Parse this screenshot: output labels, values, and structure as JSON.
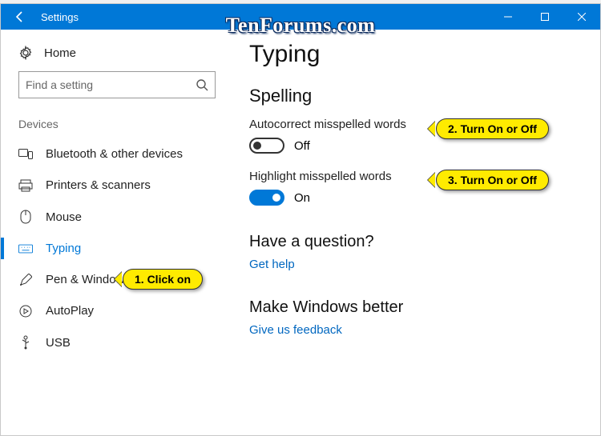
{
  "titlebar": {
    "title": "Settings"
  },
  "sidebar": {
    "home_label": "Home",
    "search_placeholder": "Find a setting",
    "group_label": "Devices",
    "items": [
      {
        "label": "Bluetooth & other devices"
      },
      {
        "label": "Printers & scanners"
      },
      {
        "label": "Mouse"
      },
      {
        "label": "Typing"
      },
      {
        "label": "Pen & Windows Ink"
      },
      {
        "label": "AutoPlay"
      },
      {
        "label": "USB"
      }
    ]
  },
  "content": {
    "page_title": "Typing",
    "section1_title": "Spelling",
    "option1_label": "Autocorrect misspelled words",
    "option1_state": "Off",
    "option2_label": "Highlight misspelled words",
    "option2_state": "On",
    "question_title": "Have a question?",
    "help_link": "Get help",
    "better_title": "Make Windows better",
    "feedback_link": "Give us feedback"
  },
  "annotations": {
    "c1": "1. Click on",
    "c2": "2. Turn On or Off",
    "c3": "3. Turn On or Off"
  },
  "watermark": "TenForums.com"
}
